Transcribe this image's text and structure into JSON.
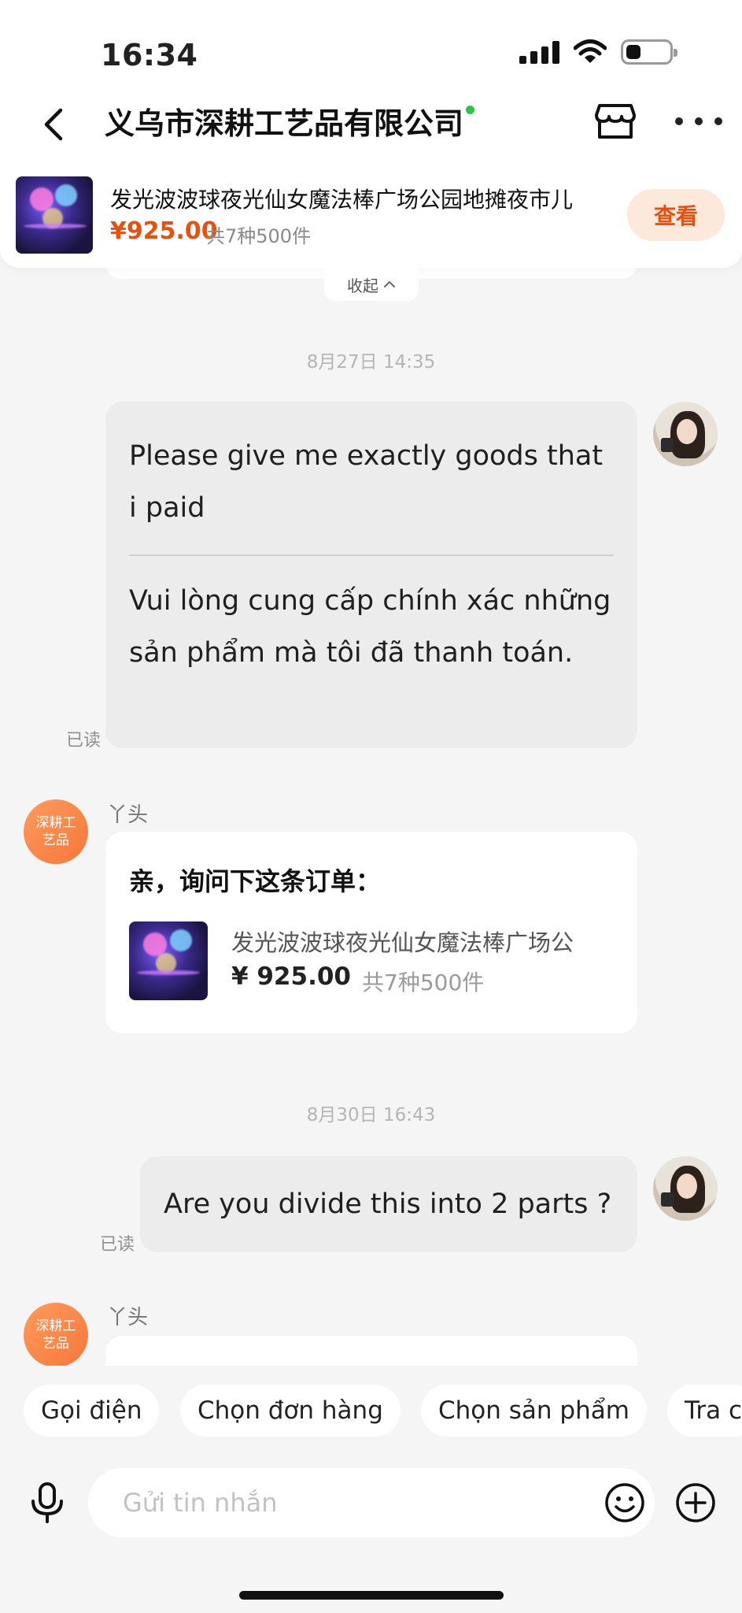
{
  "status_bar": {
    "time": "16:34"
  },
  "header": {
    "title": "义乌市深耕工艺品有限公司"
  },
  "product_bar": {
    "title": "发光波波球夜光仙女魔法棒广场公园地摊夜市儿",
    "price": "¥925.00",
    "summary": "共7种500件",
    "view_label": "查看",
    "collapse_label": "收起"
  },
  "messages": [
    {
      "type": "timestamp",
      "text": "8月27日 14:35"
    },
    {
      "type": "sent",
      "text": "Please give me exactly goods that i paid",
      "translation": "Vui lòng cung cấp chính xác những sản phẩm mà tôi đã thanh toán.",
      "status": "已读"
    },
    {
      "type": "order_card",
      "sender": "丫头",
      "avatar_text": "深耕工艺品",
      "heading": "亲，询问下这条订单：",
      "product_title": "发光波波球夜光仙女魔法棒广场公",
      "price": "¥ 925.00",
      "summary": "共7种500件"
    },
    {
      "type": "timestamp",
      "text": "8月30日 16:43"
    },
    {
      "type": "sent",
      "text": "Are you divide this into 2 parts ?",
      "status": "已读"
    },
    {
      "type": "received",
      "sender": "丫头",
      "avatar_text": "深耕工艺品"
    }
  ],
  "quick_actions": [
    "Gọi điện",
    "Chọn đơn hàng",
    "Chọn sản phẩm",
    "Tra c"
  ],
  "input": {
    "placeholder": "Gửi tin nhắn"
  },
  "colors": {
    "accent": "#e8500f",
    "accent_bg": "#fde8dc",
    "online": "#2ec24a",
    "avatar_shop": "#f5783a"
  },
  "icons": [
    "back-icon",
    "store-icon",
    "more-icon",
    "chevron-up-icon",
    "mic-icon",
    "emoji-icon",
    "plus-icon"
  ]
}
